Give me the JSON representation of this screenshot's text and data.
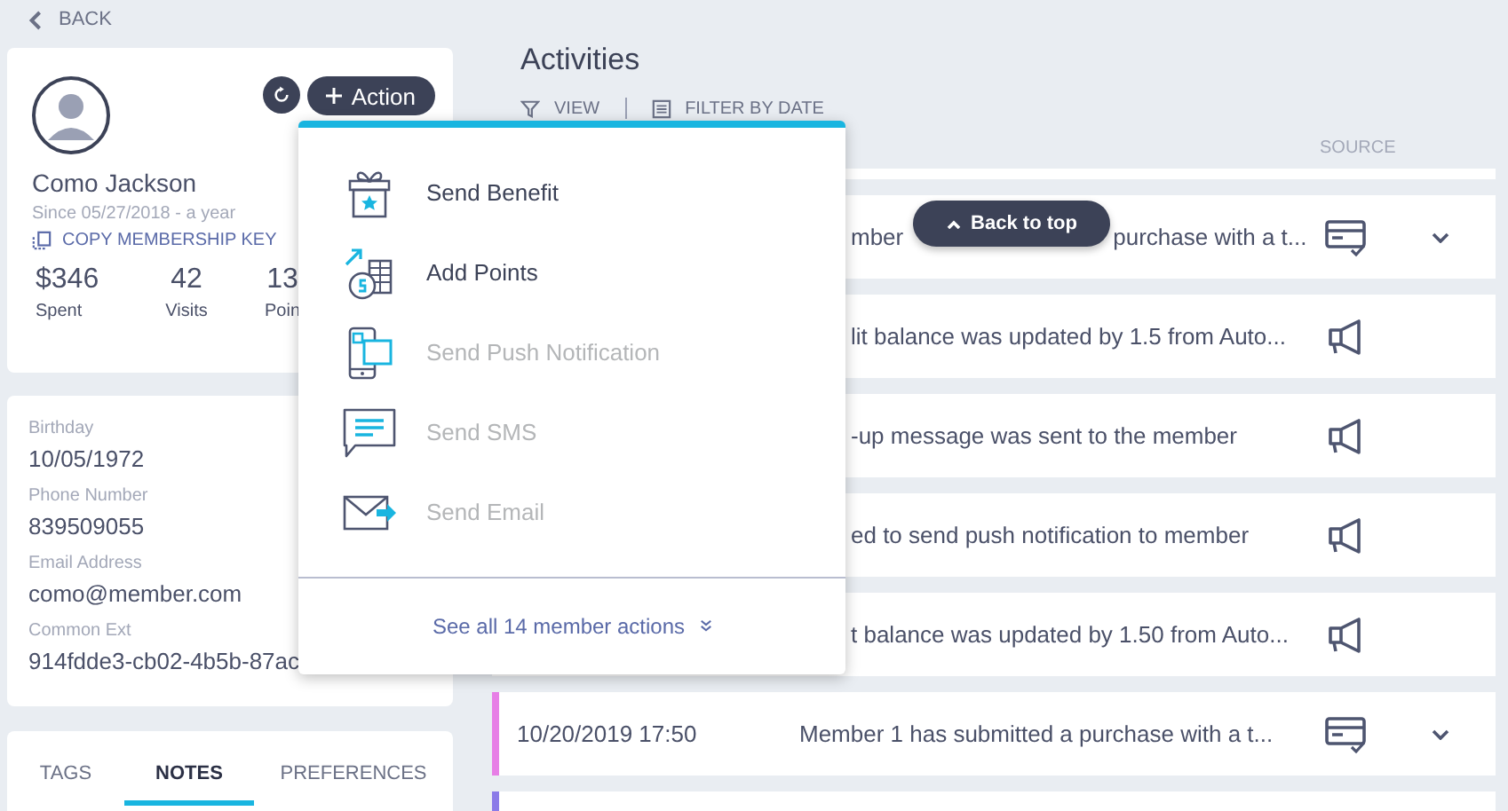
{
  "back": {
    "label": "BACK"
  },
  "member": {
    "name": "Como Jackson",
    "since": "Since 05/27/2018 - a year",
    "copy_key": "COPY MEMBERSHIP KEY",
    "action_button": "Action",
    "stats": [
      {
        "value": "$346",
        "label": "Spent"
      },
      {
        "value": "42",
        "label": "Visits"
      },
      {
        "value": "13",
        "label": "Poin"
      }
    ]
  },
  "details": [
    {
      "label": "Birthday",
      "value": "10/05/1972"
    },
    {
      "label": "Phone Number",
      "value": "839509055"
    },
    {
      "label": "Email Address",
      "value": "como@member.com"
    },
    {
      "label": "Common Ext",
      "value": "914fdde3-cb02-4b5b-87ac"
    }
  ],
  "tabs": [
    {
      "label": "TAGS",
      "selected": false
    },
    {
      "label": "NOTES",
      "selected": true
    },
    {
      "label": "PREFERENCES",
      "selected": false
    }
  ],
  "activities": {
    "title": "Activities",
    "toolbar": {
      "view": "VIEW",
      "filter": "FILTER BY DATE"
    },
    "source_header": "SOURCE",
    "back_to_top": "Back to top",
    "rows": [
      {
        "text_parts": [
          "mber",
          "purchase with a t..."
        ],
        "kind": "purchase",
        "expandable": true
      },
      {
        "text_parts": [
          "lit balance was updated by 1.5 from Auto..."
        ],
        "kind": "campaign",
        "expandable": false
      },
      {
        "text_parts": [
          "-up message was sent to the member"
        ],
        "kind": "campaign",
        "expandable": false
      },
      {
        "text_parts": [
          "ed to send push notification to member"
        ],
        "kind": "campaign",
        "expandable": false
      },
      {
        "text_parts": [
          "t balance was updated by 1.50 from Auto..."
        ],
        "kind": "campaign",
        "expandable": false
      },
      {
        "date": "10/20/2019 17:50",
        "text_parts": [
          "Member 1 has submitted a purchase with a t..."
        ],
        "kind": "purchase",
        "expandable": true,
        "color": "#e77fe6"
      },
      {
        "color": "#8b7be8"
      }
    ]
  },
  "action_menu": {
    "items": [
      {
        "kind": "gift",
        "label": "Send Benefit",
        "disabled": false
      },
      {
        "kind": "points",
        "label": "Add Points",
        "disabled": false
      },
      {
        "kind": "push",
        "label": "Send Push Notification",
        "disabled": true
      },
      {
        "kind": "sms",
        "label": "Send SMS",
        "disabled": true
      },
      {
        "kind": "email",
        "label": "Send Email",
        "disabled": true
      }
    ],
    "footer": "See all 14 member actions"
  }
}
